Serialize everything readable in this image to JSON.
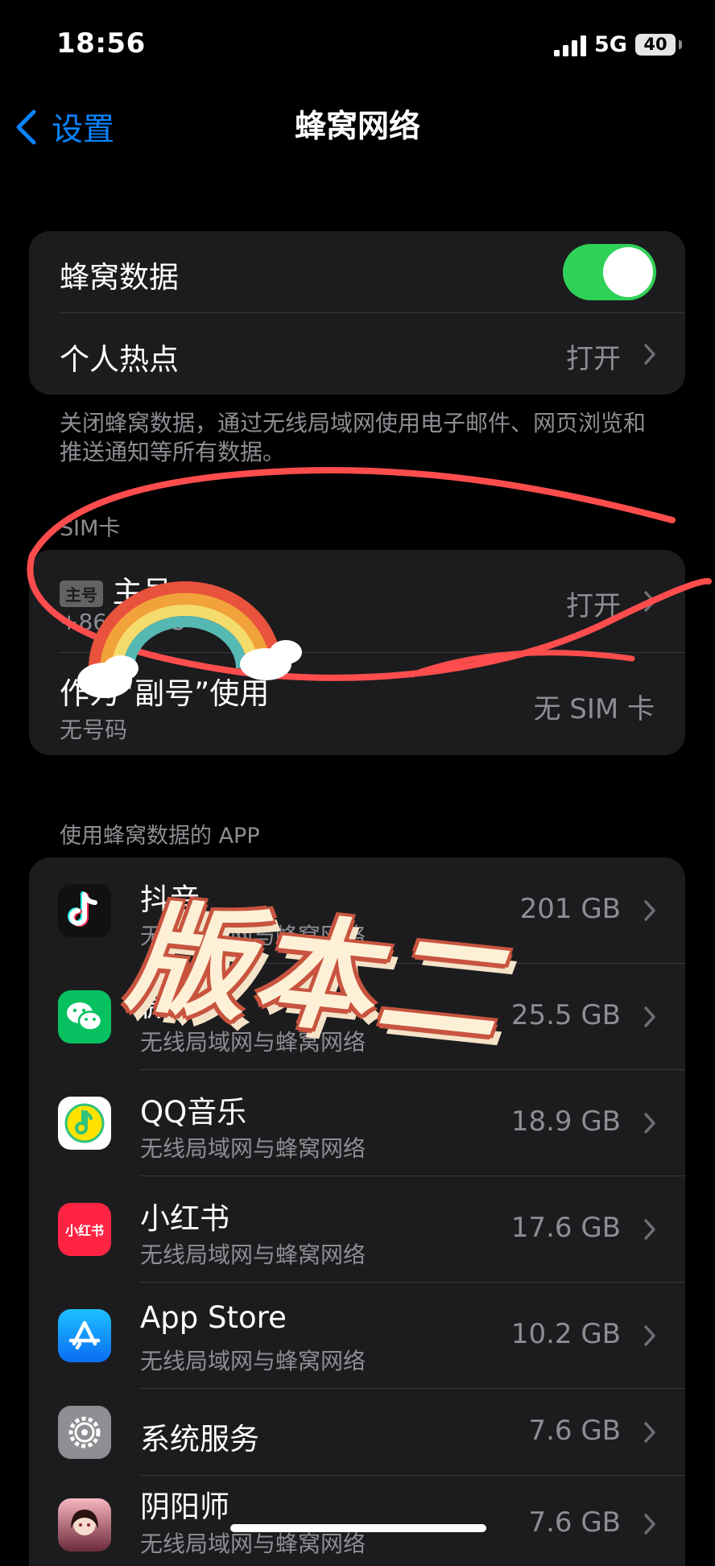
{
  "status_bar": {
    "time": "18:56",
    "network": "5G",
    "battery": "40"
  },
  "nav": {
    "back_label": "设置",
    "title": "蜂窝网络"
  },
  "cellular_group": {
    "cellular_data_label": "蜂窝数据",
    "cellular_data_on": true,
    "hotspot_label": "个人热点",
    "hotspot_value": "打开"
  },
  "cellular_footnote": "关闭蜂窝数据，通过无线局域网使用电子邮件、网页浏览和推送通知等所有数据。",
  "sim_section": {
    "header": "SIM卡",
    "primary": {
      "badge": "主号",
      "label": "主号",
      "number": "+86 ··· 985",
      "value": "打开"
    },
    "secondary": {
      "label": "作为“副号”使用",
      "sub": "无号码",
      "value": "无 SIM 卡"
    }
  },
  "apps_section": {
    "header": "使用蜂窝数据的 APP",
    "apps": [
      {
        "name": "抖音",
        "sub": "无线局域网与蜂窝网络",
        "usage": "201 GB",
        "icon": "douyin-icon"
      },
      {
        "name": "微信",
        "sub": "无线局域网与蜂窝网络",
        "usage": "25.5 GB",
        "icon": "wechat-icon"
      },
      {
        "name": "QQ音乐",
        "sub": "无线局域网与蜂窝网络",
        "usage": "18.9 GB",
        "icon": "qq-music-icon"
      },
      {
        "name": "小红书",
        "sub": "无线局域网与蜂窝网络",
        "usage": "17.6 GB",
        "icon": "xiaohongshu-icon",
        "icon_text": "小红书"
      },
      {
        "name": "App Store",
        "sub": "无线局域网与蜂窝网络",
        "usage": "10.2 GB",
        "icon": "app-store-icon"
      },
      {
        "name": "系统服务",
        "sub": "",
        "usage": "7.6 GB",
        "icon": "gear-icon"
      },
      {
        "name": "阴阳师",
        "sub": "无线局域网与蜂窝网络",
        "usage": "7.6 GB",
        "icon": "onmyoji-icon"
      }
    ]
  },
  "overlay": {
    "stamp_text": "版本二"
  },
  "colors": {
    "accent": "#0a84ff",
    "toggle_on": "#30d158",
    "marker": "#ff4d4d"
  }
}
